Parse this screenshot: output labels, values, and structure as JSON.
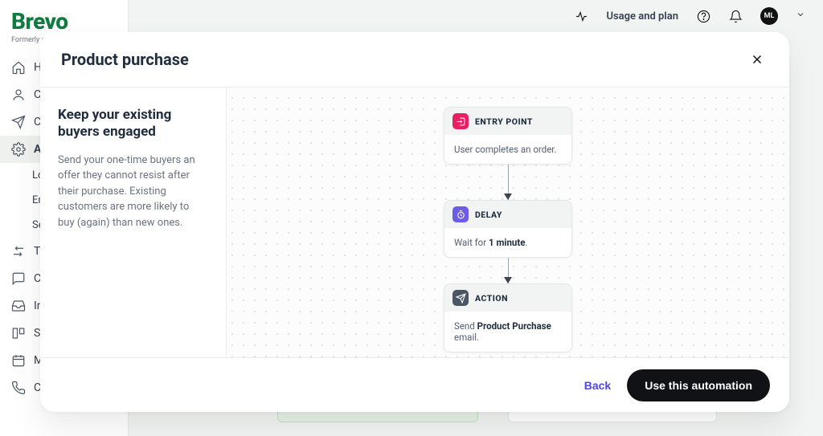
{
  "brand": {
    "name": "Brevo",
    "tagline": "Formerly send"
  },
  "topbar": {
    "usage_label": "Usage and plan",
    "avatar_initials": "ML"
  },
  "sidebar": {
    "items": [
      {
        "label": "Hom",
        "icon": "home-icon"
      },
      {
        "label": "Con",
        "icon": "user-icon"
      },
      {
        "label": "Can",
        "icon": "send-icon"
      },
      {
        "label": "Aut",
        "icon": "gear-icon",
        "active": true
      },
      {
        "label": "Log",
        "sub": true
      },
      {
        "label": "Ema",
        "sub": true
      },
      {
        "label": "Sett",
        "sub": true
      },
      {
        "label": "Trai",
        "icon": "transfer-icon"
      },
      {
        "label": "Con",
        "icon": "chat-icon"
      },
      {
        "label": "Inbc",
        "icon": "inbox-icon"
      },
      {
        "label": "Sale",
        "icon": "layout-icon"
      },
      {
        "label": "Mee",
        "icon": "calendar-icon"
      },
      {
        "label": "Call",
        "icon": "phone-icon"
      }
    ]
  },
  "modal": {
    "title": "Product purchase",
    "info_heading": "Keep your existing buyers engaged",
    "info_body": "Send your one-time buyers an offer they cannot resist after their purchase. Existing customers are more likely to buy (again) than new ones.",
    "flow": {
      "entry": {
        "label": "ENTRY POINT",
        "body": "User completes an order.",
        "icon_color": "#e91e63"
      },
      "delay": {
        "label": "DELAY",
        "body_prefix": "Wait for ",
        "body_bold": "1 minute",
        "body_suffix": ".",
        "icon_color": "#6c5ce7"
      },
      "action": {
        "label": "ACTION",
        "body_prefix": "Send ",
        "body_bold": "Product Purchase",
        "body_suffix": " email.",
        "icon_color": "#4b5563"
      }
    },
    "footer": {
      "back_label": "Back",
      "primary_label": "Use this automation"
    }
  }
}
